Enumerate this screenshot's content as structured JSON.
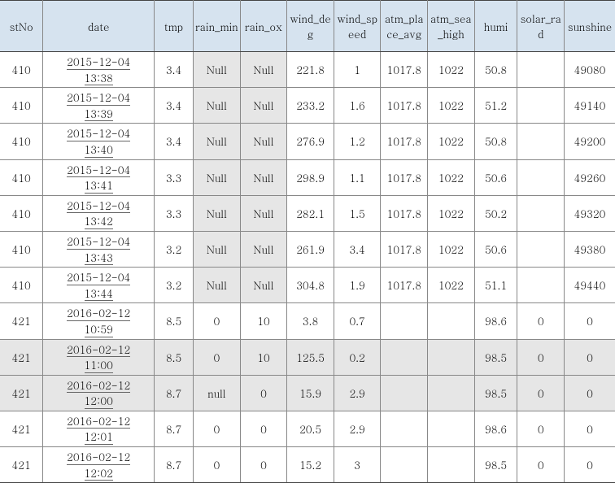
{
  "chart_data": {
    "type": "table",
    "columns": [
      "stNo",
      "date",
      "tmp",
      "rain_min",
      "rain_ox",
      "wind_deg",
      "wind_speed",
      "atm_place_avg",
      "atm_sea_high",
      "humi",
      "solar_rad",
      "sunshine"
    ],
    "rows": [
      {
        "stNo": "410",
        "date": "2015-12-04 13:38",
        "tmp": "3.4",
        "rain_min": "Null",
        "rain_ox": "Null",
        "wind_deg": "221.8",
        "wind_speed": "1",
        "atm_place_avg": "1017.8",
        "atm_sea_high": "1022",
        "humi": "50.8",
        "solar_rad": "",
        "sunshine": "49080"
      },
      {
        "stNo": "410",
        "date": "2015-12-04 13:39",
        "tmp": "3.4",
        "rain_min": "Null",
        "rain_ox": "Null",
        "wind_deg": "233.2",
        "wind_speed": "1.6",
        "atm_place_avg": "1017.8",
        "atm_sea_high": "1022",
        "humi": "51.2",
        "solar_rad": "",
        "sunshine": "49140"
      },
      {
        "stNo": "410",
        "date": "2015-12-04 13:40",
        "tmp": "3.4",
        "rain_min": "Null",
        "rain_ox": "Null",
        "wind_deg": "276.9",
        "wind_speed": "1.2",
        "atm_place_avg": "1017.8",
        "atm_sea_high": "1022",
        "humi": "50.8",
        "solar_rad": "",
        "sunshine": "49200"
      },
      {
        "stNo": "410",
        "date": "2015-12-04 13:41",
        "tmp": "3.3",
        "rain_min": "Null",
        "rain_ox": "Null",
        "wind_deg": "298.9",
        "wind_speed": "1.1",
        "atm_place_avg": "1017.8",
        "atm_sea_high": "1022",
        "humi": "50.6",
        "solar_rad": "",
        "sunshine": "49260"
      },
      {
        "stNo": "410",
        "date": "2015-12-04 13:42",
        "tmp": "3.3",
        "rain_min": "Null",
        "rain_ox": "Null",
        "wind_deg": "282.1",
        "wind_speed": "1.5",
        "atm_place_avg": "1017.8",
        "atm_sea_high": "1022",
        "humi": "50.2",
        "solar_rad": "",
        "sunshine": "49320"
      },
      {
        "stNo": "410",
        "date": "2015-12-04 13:43",
        "tmp": "3.2",
        "rain_min": "Null",
        "rain_ox": "Null",
        "wind_deg": "261.9",
        "wind_speed": "3.4",
        "atm_place_avg": "1017.8",
        "atm_sea_high": "1022",
        "humi": "50.6",
        "solar_rad": "",
        "sunshine": "49380"
      },
      {
        "stNo": "410",
        "date": "2015-12-04 13:44",
        "tmp": "3.2",
        "rain_min": "Null",
        "rain_ox": "Null",
        "wind_deg": "304.8",
        "wind_speed": "1.9",
        "atm_place_avg": "1017.8",
        "atm_sea_high": "1022",
        "humi": "51.1",
        "solar_rad": "",
        "sunshine": "49440"
      },
      {
        "stNo": "421",
        "date": "2016-02-12 10:59",
        "tmp": "8.5",
        "rain_min": "0",
        "rain_ox": "10",
        "wind_deg": "3.8",
        "wind_speed": "0.7",
        "atm_place_avg": "",
        "atm_sea_high": "",
        "humi": "98.6",
        "solar_rad": "0",
        "sunshine": "0"
      },
      {
        "stNo": "421",
        "date": "2016-02-12 11:00",
        "tmp": "8.5",
        "rain_min": "0",
        "rain_ox": "10",
        "wind_deg": "125.5",
        "wind_speed": "0.2",
        "atm_place_avg": "",
        "atm_sea_high": "",
        "humi": "98.5",
        "solar_rad": "0",
        "sunshine": "0",
        "rowShade": true
      },
      {
        "stNo": "421",
        "date": "2016-02-12 12:00",
        "tmp": "8.7",
        "rain_min": "null",
        "rain_ox": "0",
        "wind_deg": "15.9",
        "wind_speed": "2.9",
        "atm_place_avg": "",
        "atm_sea_high": "",
        "humi": "98.5",
        "solar_rad": "0",
        "sunshine": "0",
        "rowShade": true
      },
      {
        "stNo": "421",
        "date": "2016-02-12 12:01",
        "tmp": "8.7",
        "rain_min": "0",
        "rain_ox": "0",
        "wind_deg": "20.5",
        "wind_speed": "2.9",
        "atm_place_avg": "",
        "atm_sea_high": "",
        "humi": "98.6",
        "solar_rad": "0",
        "sunshine": "0"
      },
      {
        "stNo": "421",
        "date": "2016-02-12 12:02",
        "tmp": "8.7",
        "rain_min": "0",
        "rain_ox": "0",
        "wind_deg": "15.2",
        "wind_speed": "3",
        "atm_place_avg": "",
        "atm_sea_high": "",
        "humi": "98.5",
        "solar_rad": "0",
        "sunshine": "0"
      }
    ]
  },
  "headers": {
    "stNo": "stNo",
    "date": "date",
    "tmp": "tmp",
    "rain_min": "rain_min",
    "rain_ox": "rain_ox",
    "wind_deg": "wind_deg",
    "wind_speed": "wind_speed",
    "atm_place_avg": "atm_place_avg",
    "atm_sea_high": "atm_sea_high",
    "humi": "humi",
    "solar_rad": "solar_rad",
    "sunshine": "sunshine"
  }
}
